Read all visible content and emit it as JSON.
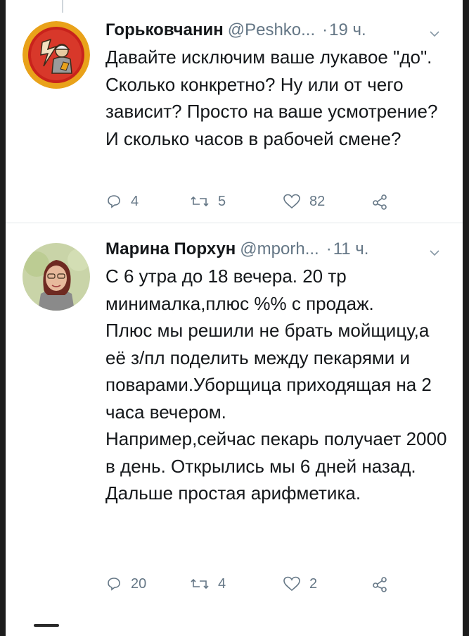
{
  "tweets": [
    {
      "name": "Горьковчанин",
      "handle": "@Peshko...",
      "dot": "·",
      "time": "19 ч.",
      "text": "Давайте исключим ваше лукавое \"до\". Сколько конкретно? Ну или от чего зависит? Просто на ваше усмотрение? И сколько часов в рабочей смене?",
      "replies": "4",
      "retweets": "5",
      "likes": "82"
    },
    {
      "name": "Марина Порхун",
      "handle": "@mporh...",
      "dot": "·",
      "time": "11 ч.",
      "text": "С 6 утра до 18 вечера. 20 тр минималка,плюс %% с продаж.\nПлюс  мы решили не брать мойщицу,а её з/пл поделить между пекарями и поварами.Уборщица приходящая на 2 часа вечером.\nНапример,сейчас пекарь получает 2000 в день. Открылись мы 6 дней назад. Дальше простая арифметика.",
      "replies": "20",
      "retweets": "4",
      "likes": "2"
    }
  ],
  "icons": {
    "reply": "reply-icon",
    "retweet": "retweet-icon",
    "like": "heart-icon",
    "share": "share-icon",
    "menu": "chevron-down-icon"
  },
  "colors": {
    "text": "#14171a",
    "secondary": "#657786",
    "divider": "#e3e7ea"
  }
}
